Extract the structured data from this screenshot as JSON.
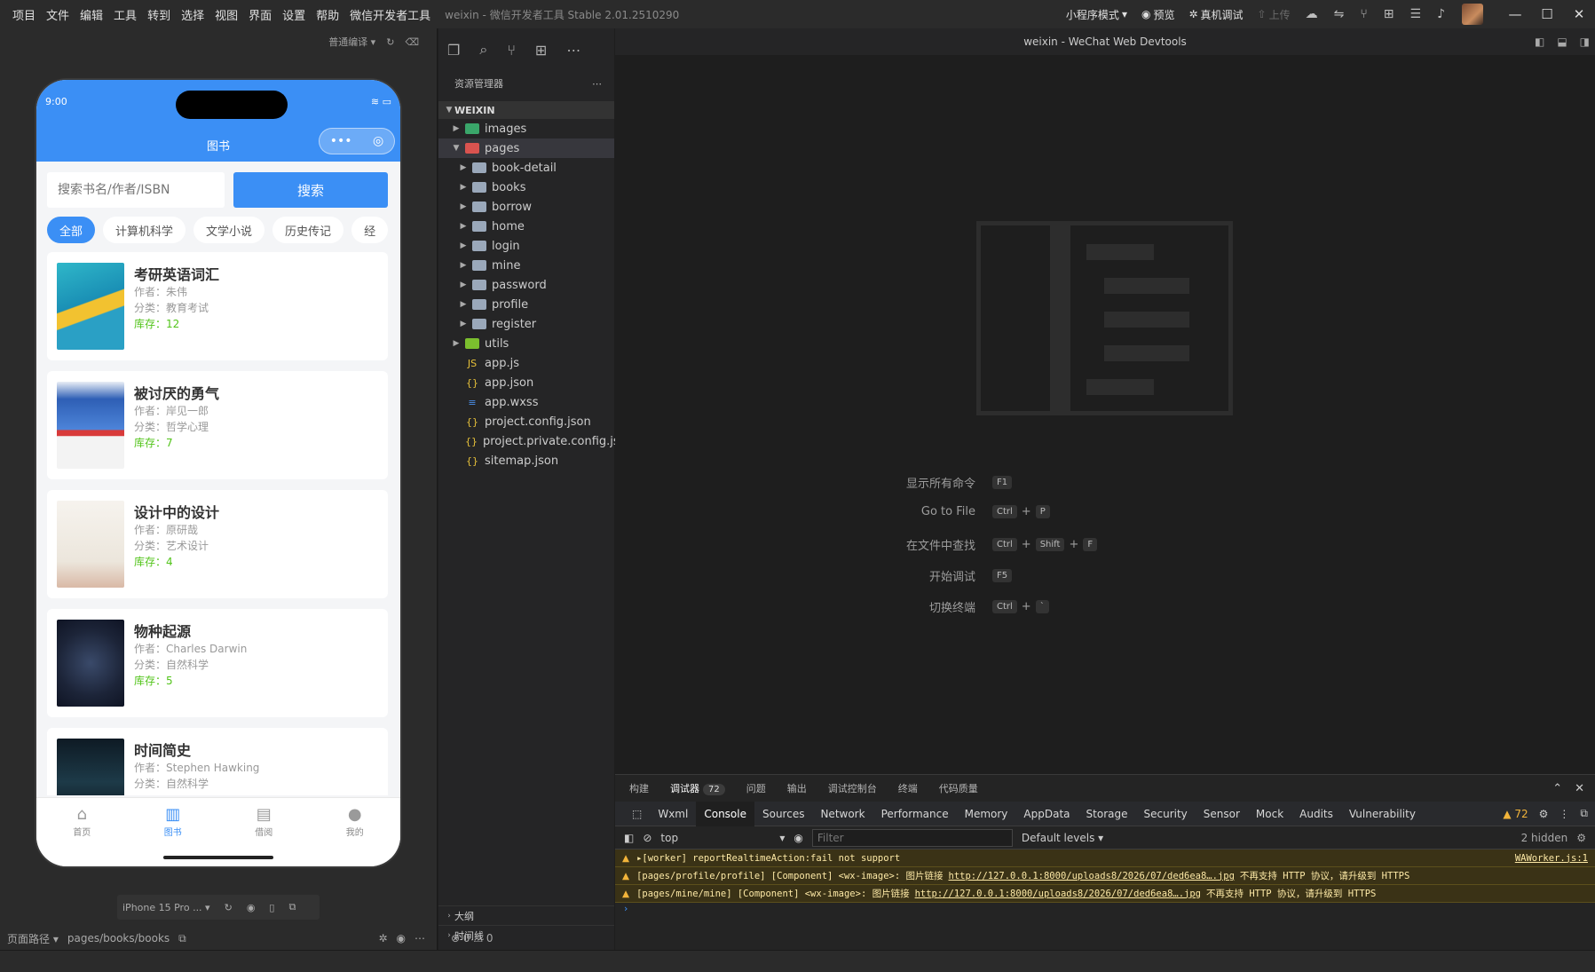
{
  "titlebar": {
    "menus": [
      "项目",
      "文件",
      "编辑",
      "工具",
      "转到",
      "选择",
      "视图",
      "界面",
      "设置",
      "帮助",
      "微信开发者工具"
    ],
    "title": "weixin - 微信开发者工具 Stable 2.01.2510290",
    "mode": "小程序模式",
    "preview": "预览",
    "real_debug": "真机调试",
    "upload": "上传"
  },
  "simulator": {
    "compile_mode": "普通编译",
    "status_time": "9:00",
    "nav_title": "图书",
    "search_placeholder": "搜索书名/作者/ISBN",
    "search_button": "搜索",
    "categories": [
      "全部",
      "计算机科学",
      "文学小说",
      "历史传记",
      "经"
    ],
    "books": [
      {
        "title": "考研英语词汇",
        "author": "作者：朱伟",
        "category": "分类：教育考试",
        "stock": "库存：12"
      },
      {
        "title": "被讨厌的勇气",
        "author": "作者：岸见一郎",
        "category": "分类：哲学心理",
        "stock": "库存：7"
      },
      {
        "title": "设计中的设计",
        "author": "作者：原研哉",
        "category": "分类：艺术设计",
        "stock": "库存：4"
      },
      {
        "title": "物种起源",
        "author": "作者：Charles Darwin",
        "category": "分类：自然科学",
        "stock": "库存：5"
      },
      {
        "title": "时间简史",
        "author": "作者：Stephen Hawking",
        "category": "分类：自然科学",
        "stock": ""
      }
    ],
    "tabs": [
      "首页",
      "图书",
      "借阅",
      "我的"
    ],
    "device": "iPhone 15 Pro ...",
    "page_path_label": "页面路径",
    "page_path": "pages/books/books"
  },
  "explorer": {
    "header": "资源管理器",
    "workspace": "WEIXIN",
    "tree": {
      "images": "images",
      "pages": "pages",
      "subfolders": [
        "book-detail",
        "books",
        "borrow",
        "home",
        "login",
        "mine",
        "password",
        "profile",
        "register"
      ],
      "utils": "utils",
      "files": [
        "app.js",
        "app.json",
        "app.wxss",
        "project.config.json",
        "project.private.config.js...",
        "sitemap.json"
      ]
    },
    "outline": "大纲",
    "timeline": "时间线",
    "problems": "⊗ 0 ⚠ 0"
  },
  "editor": {
    "tab_title": "weixin - WeChat Web Devtools",
    "commands": [
      {
        "label": "显示所有命令",
        "keys": [
          "F1"
        ]
      },
      {
        "label": "Go to File",
        "keys": [
          "Ctrl",
          "+",
          "P"
        ]
      },
      {
        "label": "在文件中查找",
        "keys": [
          "Ctrl",
          "+",
          "Shift",
          "+",
          "F"
        ]
      },
      {
        "label": "开始调试",
        "keys": [
          "F5"
        ]
      },
      {
        "label": "切换终端",
        "keys": [
          "Ctrl",
          "+",
          "`"
        ]
      }
    ]
  },
  "devtools": {
    "tabs": [
      "构建",
      "调试器",
      "问题",
      "输出",
      "调试控制台",
      "终端",
      "代码质量"
    ],
    "debugger_badge": "72",
    "panels": [
      "Wxml",
      "Console",
      "Sources",
      "Network",
      "Performance",
      "Memory",
      "AppData",
      "Storage",
      "Security",
      "Sensor",
      "Mock",
      "Audits",
      "Vulnerability"
    ],
    "warning_count": "72",
    "context": "top",
    "filter_placeholder": "Filter",
    "levels": "Default levels",
    "hidden": "2 hidden",
    "logs": [
      {
        "text": "▸[worker] reportRealtimeAction:fail not support",
        "link": "",
        "tail": "",
        "source": "WAWorker.js:1"
      },
      {
        "text": "[pages/profile/profile] [Component] <wx-image>: 图片链接",
        "link": "http://127.0.0.1:8000/uploads8/2026/07/ded6ea8….jpg",
        "tail": "不再支持 HTTP 协议，请升级到 HTTPS",
        "source": ""
      },
      {
        "text": "[pages/mine/mine] [Component] <wx-image>: 图片链接",
        "link": "http://127.0.0.1:8000/uploads8/2026/07/ded6ea8….jpg",
        "tail": "不再支持 HTTP 协议，请升级到 HTTPS",
        "source": ""
      }
    ]
  },
  "colors": {
    "accent": "#3b8ff5",
    "stock_green": "#52c41a",
    "warning": "#f2b43a"
  }
}
